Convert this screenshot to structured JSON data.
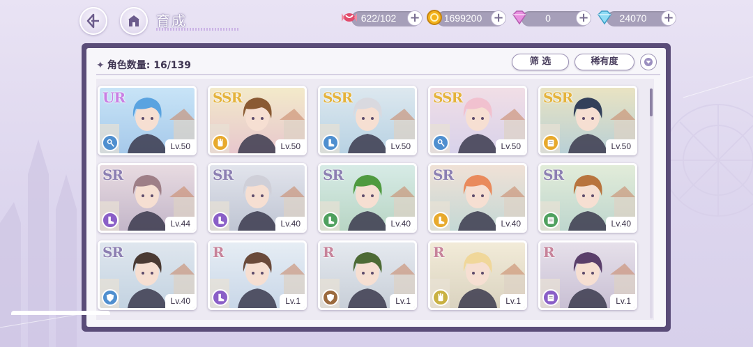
{
  "header": {
    "title": "育成",
    "resources": [
      {
        "name": "candy",
        "value": "622/102",
        "icon": "candy-icon",
        "color": "#e24a6b"
      },
      {
        "name": "gold",
        "value": "1699200",
        "icon": "gold-coin-icon",
        "color": "#f3b21b"
      },
      {
        "name": "pink-diamond",
        "value": "0",
        "icon": "pink-diamond-icon",
        "color": "#e07fd2"
      },
      {
        "name": "blue-diamond",
        "value": "24070",
        "icon": "blue-diamond-icon",
        "color": "#5ec6e8"
      }
    ],
    "plus_label": "+"
  },
  "panel": {
    "count_label": "角色数量: 16/139",
    "filter_label": "筛 选",
    "rarity_label": "稀有度",
    "scroll_position": 0
  },
  "cards": [
    {
      "rarity": "UR",
      "level": "Lv.50",
      "class": "blue",
      "classIcon": "key-icon",
      "hair": "#5aa3e0",
      "bg": [
        "#c8e4f7",
        "#a6c9ea"
      ],
      "rarColor": "#c97fe4"
    },
    {
      "rarity": "SSR",
      "level": "Lv.50",
      "class": "gold",
      "classIcon": "glove-icon",
      "hair": "#8a5a33",
      "bg": [
        "#f3eaca",
        "#e7c7cd"
      ],
      "rarColor": "#e4b33c"
    },
    {
      "rarity": "SSR",
      "level": "Lv.50",
      "class": "blue",
      "classIcon": "boot-icon",
      "hair": "#d9d9df",
      "bg": [
        "#dde8ef",
        "#b8d2e3"
      ],
      "rarColor": "#e4b33c"
    },
    {
      "rarity": "SSR",
      "level": "Lv.50",
      "class": "blue",
      "classIcon": "key-icon",
      "hair": "#f1c1cf",
      "bg": [
        "#f1dee6",
        "#d8d2ea"
      ],
      "rarColor": "#e4b33c"
    },
    {
      "rarity": "SSR",
      "level": "Lv.50",
      "class": "gold",
      "classIcon": "book-icon",
      "hair": "#33405a",
      "bg": [
        "#e9e3c2",
        "#b9d0d6"
      ],
      "rarColor": "#e4b33c"
    },
    {
      "rarity": "SR",
      "level": "Lv.44",
      "class": "purple",
      "classIcon": "boot-icon",
      "hair": "#9e7f87",
      "bg": [
        "#e8dbe1",
        "#c3b6c9"
      ],
      "rarColor": "#8c7fb2"
    },
    {
      "rarity": "SR",
      "level": "Lv.40",
      "class": "purple",
      "classIcon": "boot-icon",
      "hair": "#cfcfd8",
      "bg": [
        "#e2e4ec",
        "#bfc5d3"
      ],
      "rarColor": "#8c7fb2"
    },
    {
      "rarity": "SR",
      "level": "Lv.40",
      "class": "green",
      "classIcon": "boot-icon",
      "hair": "#4f9a3f",
      "bg": [
        "#d7ebe6",
        "#b8d5c4"
      ],
      "rarColor": "#8c7fb2"
    },
    {
      "rarity": "SR",
      "level": "Lv.40",
      "class": "gold",
      "classIcon": "boot-icon",
      "hair": "#e98a5c",
      "bg": [
        "#f0e1d6",
        "#c4d8d5"
      ],
      "rarColor": "#8c7fb2"
    },
    {
      "rarity": "SR",
      "level": "Lv.40",
      "class": "green",
      "classIcon": "book-icon",
      "hair": "#b8743e",
      "bg": [
        "#e2ecd9",
        "#bed6ce"
      ],
      "rarColor": "#8c7fb2"
    },
    {
      "rarity": "SR",
      "level": "Lv.40",
      "class": "blue",
      "classIcon": "shield-icon",
      "hair": "#4a3a33",
      "bg": [
        "#dfe6ee",
        "#c3d3e1"
      ],
      "rarColor": "#8c7fb2"
    },
    {
      "rarity": "R",
      "level": "Lv.1",
      "class": "purple",
      "classIcon": "boot-icon",
      "hair": "#6a4a3a",
      "bg": [
        "#e6edf4",
        "#c9d7e8"
      ],
      "rarColor": "#c7839a"
    },
    {
      "rarity": "R",
      "level": "Lv.1",
      "class": "brown",
      "classIcon": "shield-icon",
      "hair": "#4d6a35",
      "bg": [
        "#e5e9ef",
        "#c8cfd8"
      ],
      "rarColor": "#c7839a"
    },
    {
      "rarity": "R",
      "level": "Lv.1",
      "class": "olive",
      "classIcon": "glove-icon",
      "hair": "#f0d79a",
      "bg": [
        "#f2ebd8",
        "#dad3c0"
      ],
      "rarColor": "#c7839a"
    },
    {
      "rarity": "R",
      "level": "Lv.1",
      "class": "purple",
      "classIcon": "book-icon",
      "hair": "#5a3f6a",
      "bg": [
        "#e6e0ea",
        "#c9c0d4"
      ],
      "rarColor": "#c7839a"
    }
  ],
  "class_colors": {
    "blue": "#4f8fcf",
    "gold": "#e7a92c",
    "purple": "#8a5fc7",
    "green": "#4ea05e",
    "brown": "#9b6a3d",
    "olive": "#c9b142"
  }
}
